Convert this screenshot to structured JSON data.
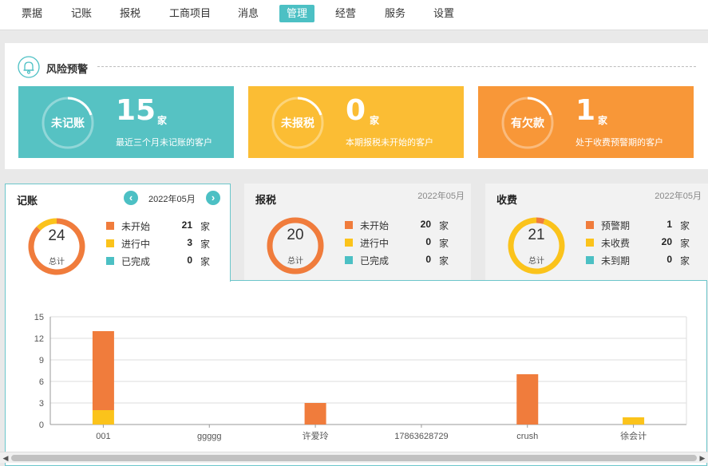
{
  "nav": {
    "items": [
      {
        "label": "票据"
      },
      {
        "label": "记账"
      },
      {
        "label": "报税"
      },
      {
        "label": "工商项目"
      },
      {
        "label": "消息"
      },
      {
        "label": "管理"
      },
      {
        "label": "经营"
      },
      {
        "label": "服务"
      },
      {
        "label": "设置"
      }
    ],
    "active": "管理"
  },
  "risk": {
    "title": "风险预警",
    "cards": [
      {
        "ring_label": "未记账",
        "count": "15",
        "unit": "家",
        "desc": "最近三个月未记账的客户",
        "color": "#56c2c3"
      },
      {
        "ring_label": "未报税",
        "count": "0",
        "unit": "家",
        "desc": "本期报税未开始的客户",
        "color": "#fbbd34"
      },
      {
        "ring_label": "有欠款",
        "count": "1",
        "unit": "家",
        "desc": "处于收费预警期的客户",
        "color": "#f89738"
      }
    ]
  },
  "stats": [
    {
      "title": "记账",
      "month": "2022年05月",
      "total": "24",
      "total_label": "总计",
      "items": [
        {
          "label": "未开始",
          "value": "21",
          "unit": "家",
          "color": "#f07c3c"
        },
        {
          "label": "进行中",
          "value": "3",
          "unit": "家",
          "color": "#fbc31b"
        },
        {
          "label": "已完成",
          "value": "0",
          "unit": "家",
          "color": "#4cc0c4"
        }
      ]
    },
    {
      "title": "报税",
      "month": "2022年05月",
      "total": "20",
      "total_label": "总计",
      "items": [
        {
          "label": "未开始",
          "value": "20",
          "unit": "家",
          "color": "#f07c3c"
        },
        {
          "label": "进行中",
          "value": "0",
          "unit": "家",
          "color": "#fbc31b"
        },
        {
          "label": "已完成",
          "value": "0",
          "unit": "家",
          "color": "#4cc0c4"
        }
      ]
    },
    {
      "title": "收费",
      "month": "2022年05月",
      "total": "21",
      "total_label": "总计",
      "items": [
        {
          "label": "预警期",
          "value": "1",
          "unit": "家",
          "color": "#f07c3c"
        },
        {
          "label": "未收费",
          "value": "20",
          "unit": "家",
          "color": "#fbc31b"
        },
        {
          "label": "未到期",
          "value": "0",
          "unit": "家",
          "color": "#4cc0c4"
        }
      ]
    }
  ],
  "chart_data": {
    "type": "bar",
    "stacked": true,
    "categories": [
      "001",
      "ggggg",
      "许爱玲",
      "17863628729",
      "crush",
      "徐会计"
    ],
    "series": [
      {
        "values": [
          2,
          0,
          0,
          0,
          0,
          1
        ],
        "color": "#fbc31b"
      },
      {
        "values": [
          11,
          0,
          3,
          0,
          7,
          0
        ],
        "color": "#f07c3c"
      }
    ],
    "yticks": [
      0,
      3,
      6,
      9,
      12,
      15
    ],
    "ylim": [
      0,
      15
    ],
    "grid": true
  }
}
